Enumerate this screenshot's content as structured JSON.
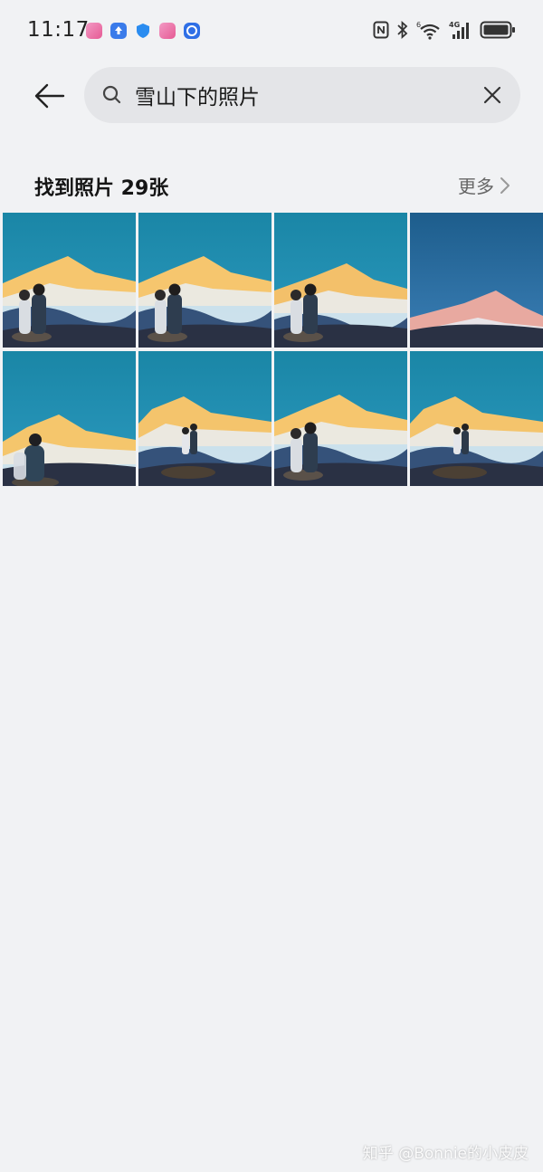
{
  "status_bar": {
    "time": "11:17",
    "notification_icons": [
      {
        "name": "app-pink-icon",
        "color": "#e86aa6"
      },
      {
        "name": "upload-icon",
        "color": "#3a7bea"
      },
      {
        "name": "shield-icon",
        "color": "#2a8cf0"
      },
      {
        "name": "app-pink-icon-2",
        "color": "#e86aa6"
      },
      {
        "name": "vpn-icon",
        "color": "#2f6fe6"
      }
    ],
    "network_label": "4G",
    "wifi_badge": "6"
  },
  "search": {
    "query": "雪山下的照片"
  },
  "results": {
    "title": "找到照片 29张",
    "more_label": "更多"
  },
  "photos": [
    {
      "name": "photo-1",
      "kind": "couple-kiss"
    },
    {
      "name": "photo-2",
      "kind": "couple-kiss"
    },
    {
      "name": "photo-3",
      "kind": "couple-hug"
    },
    {
      "name": "photo-4",
      "kind": "distant-peak"
    },
    {
      "name": "photo-5",
      "kind": "single-person"
    },
    {
      "name": "photo-6",
      "kind": "small-couple"
    },
    {
      "name": "photo-7",
      "kind": "couple-kiss"
    },
    {
      "name": "photo-8",
      "kind": "small-couple"
    }
  ],
  "watermark": "知乎 @Bonnie的小皮皮",
  "colors": {
    "background": "#f1f2f4",
    "search_box": "#e4e5e8",
    "sky": "#1f85a8",
    "peak": "#f5c46a"
  }
}
